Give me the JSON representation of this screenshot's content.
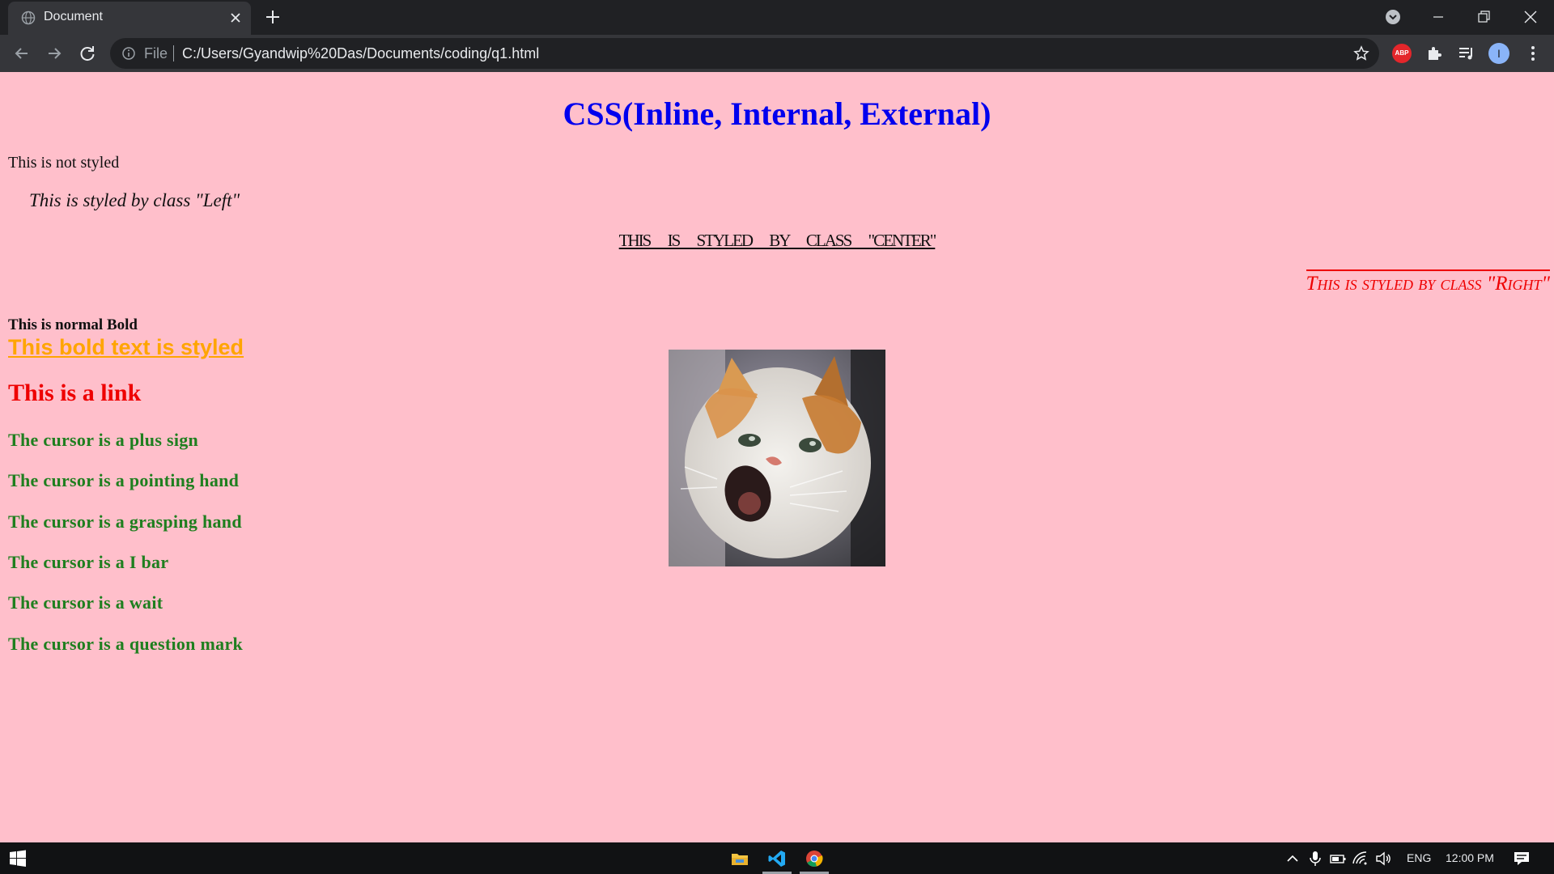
{
  "browser": {
    "tab": {
      "title": "Document"
    },
    "address_bar": {
      "scheme_label": "File",
      "url": "C:/Users/Gyandwip%20Das/Documents/coding/q1.html"
    },
    "extensions": {
      "abp_label": "ABP"
    },
    "profile": {
      "initial": "I"
    }
  },
  "page": {
    "heading": "CSS(Inline, Internal, External)",
    "not_styled": "This is not styled",
    "left_class": "This is styled by class \"Left\"",
    "center_class": "This is styled by class \"Center\"",
    "right_class": "This is styled by class \"Right\"",
    "normal_bold": "This is normal Bold",
    "styled_bold": "This bold text is styled",
    "link": "This is a link",
    "cursor_items": [
      "The cursor is a plus sign",
      "The cursor is a pointing hand",
      "The cursor is a grasping hand",
      "The cursor is a I bar",
      "The cursor is a wait",
      "The cursor is a question mark"
    ],
    "image": {
      "icon": "cat-photo"
    }
  },
  "taskbar": {
    "language": "ENG",
    "time": "12:00 PM",
    "apps": [
      "file-explorer",
      "vscode",
      "chrome"
    ]
  },
  "colors": {
    "page_background": "#ffbfcb",
    "heading": "#0000ee",
    "right_class": "#ee0000",
    "styled_bold": "#ffa500",
    "link": "#ee0000",
    "cursor_items": "#1f7f1f"
  }
}
